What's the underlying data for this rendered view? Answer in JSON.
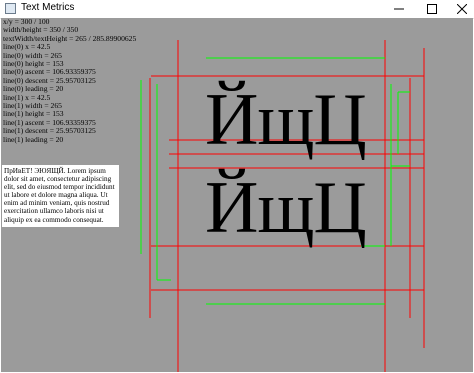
{
  "window": {
    "title": "Text Metrics"
  },
  "controls": {
    "minimize": "minimize",
    "maximize": "maximize",
    "close": "close"
  },
  "metrics": [
    "x/y = 300 / 100",
    "width/height = 350 / 350",
    "textWidth/textHeight = 265 / 285.89900625",
    "line(0) x = 42.5",
    "line(0) width = 265",
    "line(0) height = 153",
    "line(0) ascent = 106.93359375",
    "line(0) descent = 25.95703125",
    "line(0) leading = 20",
    "line(1) x = 42.5",
    "line(1) width = 265",
    "line(1) height = 153",
    "line(1) ascent = 106.93359375",
    "line(1) descent = 25.95703125",
    "line(1) leading = 20"
  ],
  "lorem": "ПрИвЕТ! ЭЮЯЩЙ. Lorem ipsum dolor sit amet, consectetur adipiscing elit, sed do eiusmod tempor incididunt ut labore et dolore magna aliqua. Ut enim ad minim veniam, quis nostrud exercitation ullamco laboris nisi ut aliquip ex ea commodo consequat.",
  "glyphs": {
    "line0": "ЙщЦ",
    "line1": "ЙщЦ"
  },
  "colors": {
    "canvas": "#9b9b9b",
    "box": "#ff0000",
    "metrics": "#00ff00"
  }
}
